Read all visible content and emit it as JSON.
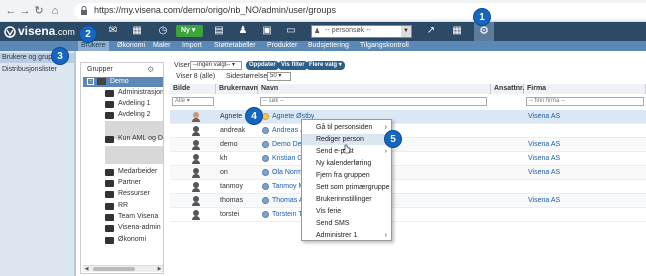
{
  "browser": {
    "url": "https://my.visena.com/demo/origo/nb_NO/admin/user/groups"
  },
  "header": {
    "logo_main": "visena",
    "logo_suffix": ".com",
    "new_label": "Ny",
    "person_search_placeholder": "-- personsøk --"
  },
  "menu": {
    "items": [
      "Brukere",
      "Økonomi",
      "Maler",
      "Import",
      "Støttetabeller",
      "Produkter",
      "Budsjettering",
      "Tilgangskontroll"
    ]
  },
  "sidebar": {
    "items": [
      "Brukere og grupper",
      "Distribusjonslister"
    ]
  },
  "groups": {
    "title": "Grupper",
    "root": "Demo",
    "items": [
      "Administrasjon",
      "Avdeling 1",
      "Avdeling 2",
      "Kun AML og Dig",
      "Medarbeider",
      "Partner",
      "Ressurser",
      "RR",
      "Team Visena",
      "Visena-admin",
      "Økonomi"
    ]
  },
  "controls": {
    "viser_label": "Viser",
    "viser_value": "--Ingen valgt--",
    "oppdater": "Oppdater",
    "vis_filter": "Vis filter",
    "flere_valg": "Flere valg",
    "count_label": "Viser 8 (alle)",
    "page_size_label": "Sidestørrelse",
    "page_size_value": "50"
  },
  "table": {
    "headers": [
      "Bilde",
      "Brukernavn",
      "Navn",
      "Ansattnr.",
      "Firma"
    ],
    "filter_select": "Alle",
    "filter_name": "-- søk --",
    "filter_company": "-- finn firma --",
    "rows": [
      {
        "username": "Agnete",
        "name": "Agnete Østby",
        "company": "Visena AS"
      },
      {
        "username": "andreak",
        "name": "Andreas J",
        "company": ""
      },
      {
        "username": "demo",
        "name": "Demo Der",
        "company": "Visena AS"
      },
      {
        "username": "kh",
        "name": "Kristian G",
        "company": "Visena AS"
      },
      {
        "username": "on",
        "name": "Ola Norma",
        "company": "Visena AS"
      },
      {
        "username": "tanmoy",
        "name": "Tanmoy M",
        "company": ""
      },
      {
        "username": "thomas",
        "name": "Thomas A",
        "company": "Visena AS"
      },
      {
        "username": "torstei",
        "name": "Torstein T",
        "company": ""
      }
    ]
  },
  "context_menu": {
    "items": [
      "Gå til personsiden",
      "Rediger person",
      "Send e-post",
      "Ny kalenderføring",
      "Fjern fra gruppen",
      "Sett som primærgruppe",
      "Brukerinnstillinger",
      "Vis ferie",
      "Send SMS",
      "Administrer 1"
    ]
  },
  "badges": [
    "1",
    "2",
    "3",
    "4",
    "5"
  ]
}
